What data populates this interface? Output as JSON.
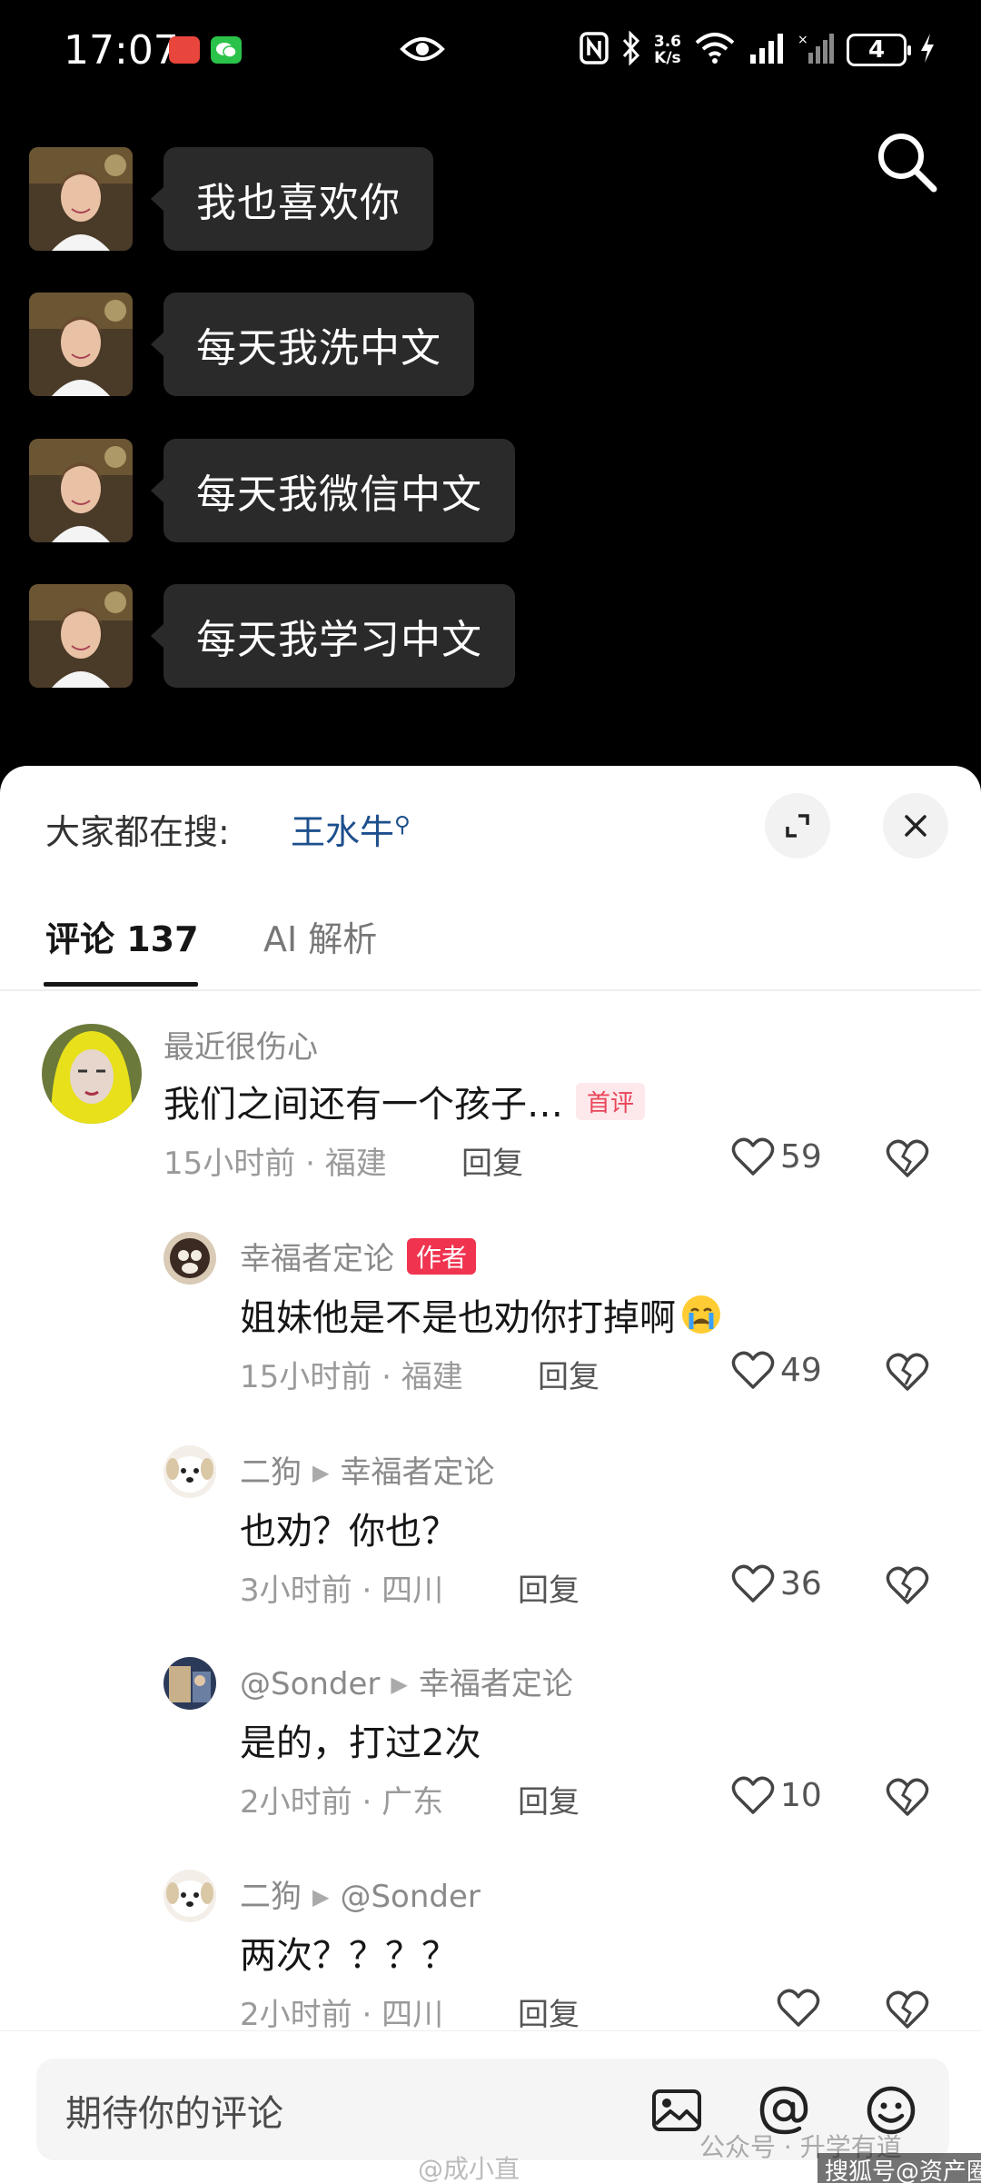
{
  "status_bar": {
    "time": "17:07",
    "net_speed_value": "3.6",
    "net_speed_unit": "K/s",
    "battery": "4"
  },
  "messages": [
    {
      "text": "我也喜欢你"
    },
    {
      "text": "每天我洗中文"
    },
    {
      "text": "每天我微信中文"
    },
    {
      "text": "每天我学习中文"
    }
  ],
  "trend": {
    "prefix": "大家都在搜:",
    "term": "王水牛"
  },
  "tabs": {
    "comments": "评论 137",
    "ai": "AI 解析"
  },
  "comments": [
    {
      "name": "最近很伤心",
      "text": "我们之间还有一个孩子…",
      "badge": "首评",
      "time": "15小时前",
      "location": "福建",
      "reply": "回复",
      "likes": "59"
    },
    {
      "name": "幸福者定论",
      "badge": "作者",
      "text": "姐妹他是不是也劝你打掉啊",
      "time": "15小时前",
      "location": "福建",
      "reply": "回复",
      "likes": "49"
    },
    {
      "name": "二狗",
      "reply_to": "幸福者定论",
      "text": "也劝？你也？",
      "time": "3小时前",
      "location": "四川",
      "reply": "回复",
      "likes": "36"
    },
    {
      "name": "@Sonder",
      "reply_to": "幸福者定论",
      "text": "是的，打过2次",
      "time": "2小时前",
      "location": "广东",
      "reply": "回复",
      "likes": "10"
    },
    {
      "name": "二狗",
      "reply_to": "@Sonder",
      "text": "两次？？？？",
      "time": "2小时前",
      "location": "四川",
      "reply": "回复"
    }
  ],
  "input": {
    "placeholder": "期待你的评论"
  },
  "watermarks": {
    "weibo": "@成小直",
    "wechat": "公众号 · 升学有道",
    "sohu": "搜狐号@资产圈"
  },
  "colors": {
    "accent_red": "#f0334f",
    "trend_blue": "#1d4f8c"
  }
}
